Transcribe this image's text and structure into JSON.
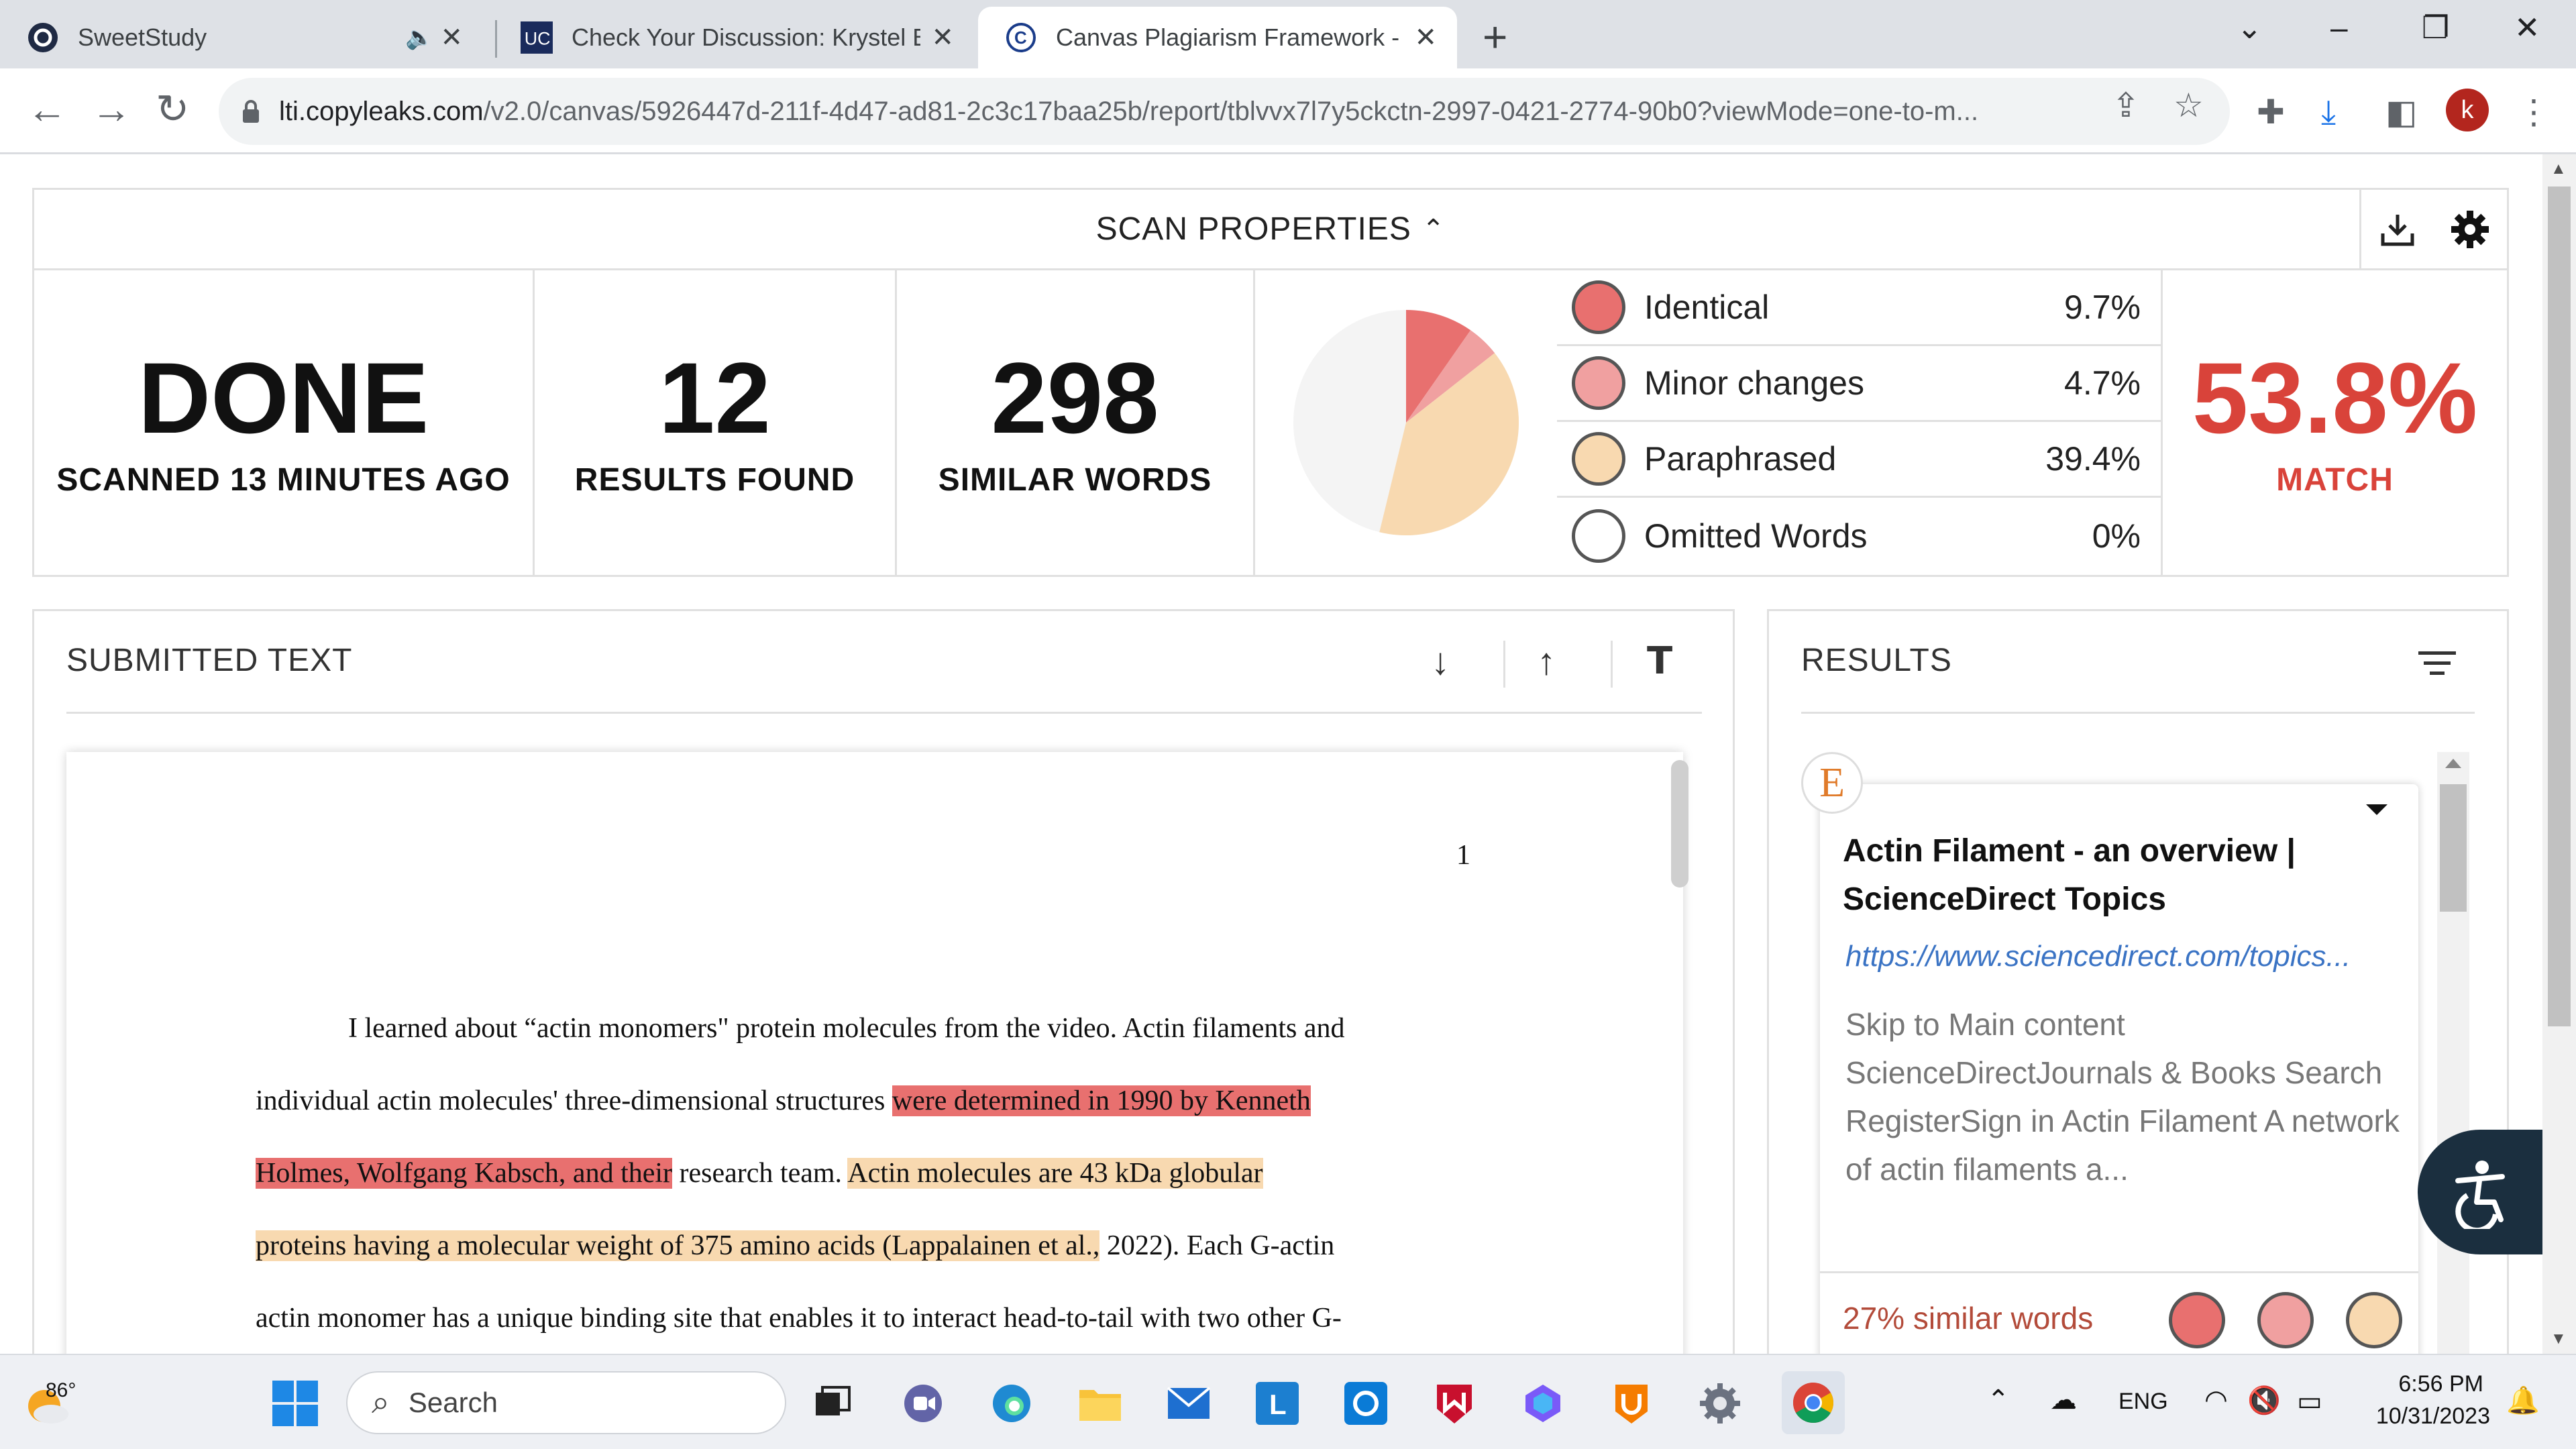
{
  "browser": {
    "tabs": [
      {
        "title": "SweetStudy",
        "favicon": "sweetstudy-logo-icon"
      },
      {
        "title": "Check Your Discussion: Krystel B",
        "favicon": "uc-logo-icon"
      },
      {
        "title": "Canvas Plagiarism Framework - C",
        "favicon": "copyleaks-logo-icon",
        "active": true
      }
    ],
    "new_tab_label": "+",
    "url_host": "lti.copyleaks.com",
    "url_path": "/v2.0/canvas/5926447d-211f-4d47-ad81-2c3c17baa25b/report/tblvvx7l7y5ckctn-2997-0421-2774-90b0?viewMode=one-to-m...",
    "profile_initial": "k"
  },
  "scan": {
    "header": "SCAN PROPERTIES",
    "status": {
      "value": "DONE",
      "label": "SCANNED 13 MINUTES AGO"
    },
    "results_found": {
      "value": "12",
      "label": "RESULTS FOUND"
    },
    "similar_words": {
      "value": "298",
      "label": "SIMILAR WORDS"
    },
    "breakdown": [
      {
        "label": "Identical",
        "value": "9.7%",
        "percent": 9.7,
        "color": "#e8706f"
      },
      {
        "label": "Minor changes",
        "value": "4.7%",
        "percent": 4.7,
        "color": "#f0a0a0"
      },
      {
        "label": "Paraphrased",
        "value": "39.4%",
        "percent": 39.4,
        "color": "#f8d9b0"
      },
      {
        "label": "Omitted Words",
        "value": "0%",
        "percent": 0,
        "color": "#ffffff"
      }
    ],
    "pie_rest_color": "#f4f4f4",
    "match": {
      "value": "53.8%",
      "label": "MATCH"
    }
  },
  "submitted": {
    "title": "SUBMITTED TEXT",
    "page_number": "1",
    "lines": [
      [
        {
          "text": "I learned about “actin monomers\" protein molecules from the video. Actin filaments and",
          "hl": ""
        }
      ],
      [
        {
          "text": "individual actin molecules' three-dimensional structures ",
          "hl": ""
        },
        {
          "text": "were determined in 1990 by Kenneth",
          "hl": "ident"
        }
      ],
      [
        {
          "text": "Holmes, Wolfgang Kabsch, and their",
          "hl": "ident"
        },
        {
          "text": " research team. ",
          "hl": ""
        },
        {
          "text": "Actin molecules are 43 kDa globular ",
          "hl": "para"
        }
      ],
      [
        {
          "text": "proteins having a molecular weight of 375 amino acids (Lappalainen et al.,",
          "hl": "para"
        },
        {
          "text": " 2022). Each G-actin",
          "hl": ""
        }
      ],
      [
        {
          "text": "actin monomer has a unique binding site that enables it to interact head-to-tail with two other G-",
          "hl": ""
        }
      ]
    ]
  },
  "results": {
    "title": "RESULTS",
    "card": {
      "logo_letter": "E",
      "title": "Actin Filament - an overview | ScienceDirect Topics",
      "url": "https://www.sciencedirect.com/topics...",
      "snippet": "Skip to Main content ScienceDirectJournals & Books Search RegisterSign in Actin Filament A network of actin filaments a...",
      "similar": "27% similar words"
    }
  },
  "taskbar": {
    "temperature": "86°",
    "search_placeholder": "Search",
    "language": "ENG",
    "time": "6:56 PM",
    "date": "10/31/2023"
  }
}
